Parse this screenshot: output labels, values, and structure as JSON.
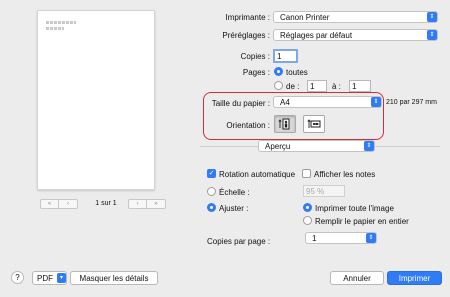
{
  "preview": {
    "page_indicator": "1 sur 1"
  },
  "printer": {
    "label": "Imprimante :",
    "value": "Canon Printer"
  },
  "presets": {
    "label": "Préréglages :",
    "value": "Réglages par défaut"
  },
  "copies": {
    "label": "Copies :",
    "value": "1"
  },
  "pages": {
    "label": "Pages :",
    "all_label": "toutes",
    "from_label": "de :",
    "from_value": "1",
    "to_label": "à :",
    "to_value": "1"
  },
  "paper_size": {
    "label": "Taille du papier :",
    "value": "A4",
    "dimensions": "210 par 297 mm"
  },
  "orientation": {
    "label": "Orientation :",
    "selected": "portrait"
  },
  "section": {
    "value": "Aperçu"
  },
  "options": {
    "auto_rotate_label": "Rotation automatique",
    "auto_rotate_checked": true,
    "show_notes_label": "Afficher les notes",
    "show_notes_checked": false,
    "scale_label": "Échelle :",
    "scale_value": "95 %",
    "fit_label": "Ajuster :",
    "print_entire_label": "Imprimer toute l'image",
    "fill_paper_label": "Remplir le papier en entier"
  },
  "copies_per_page": {
    "label": "Copies par page :",
    "value": "1"
  },
  "footer": {
    "help": "?",
    "pdf_label": "PDF",
    "hide_details_label": "Masquer les détails",
    "cancel_label": "Annuler",
    "print_label": "Imprimer"
  },
  "colors": {
    "accent": "#2f7cf6",
    "highlight": "#d62b3a"
  }
}
